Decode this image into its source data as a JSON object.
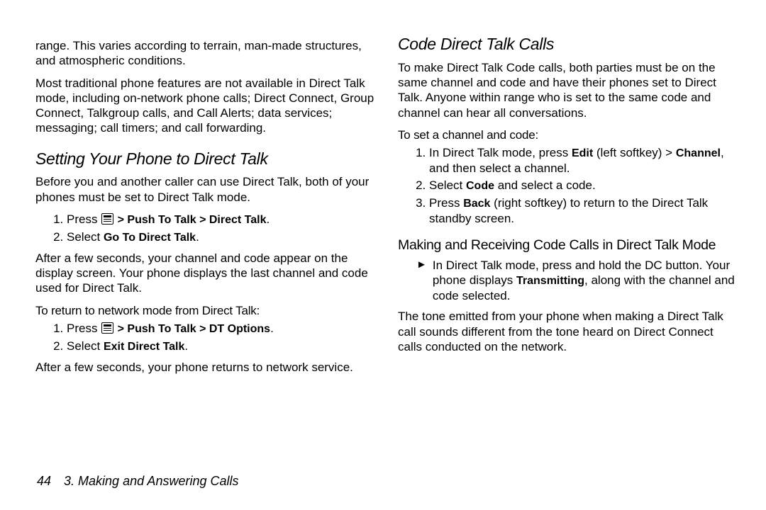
{
  "left": {
    "p_range": "range. This varies according to terrain, man-made structures, and atmospheric conditions.",
    "p_features": "Most traditional phone features are not available in Direct Talk mode, including on-network phone calls; Direct Connect, Group Connect, Talkgroup calls, and Call Alerts; data services; messaging; call timers; and call forwarding.",
    "h_setting": "Setting Your Phone to Direct Talk",
    "p_before": "Before you and another caller can use Direct Talk, both of your phones must be set to Direct Talk mode.",
    "step1_pre": "Press ",
    "step1_b": " > Push To Talk > Direct Talk",
    "step1_post": ".",
    "step2_pre": "Select ",
    "step2_b": "Go To Direct Talk",
    "step2_post": ".",
    "p_after_seconds": "After a few seconds, your channel and code appear on the display screen. Your phone displays the last channel and code used for Direct Talk.",
    "p_return_lead": "To return to network mode from Direct Talk:",
    "ret1_pre": "Press ",
    "ret1_b": " > Push To Talk > DT Options",
    "ret1_post": ".",
    "ret2_pre": "Select ",
    "ret2_b": "Exit Direct Talk",
    "ret2_post": ".",
    "p_returns": "After a few seconds, your phone returns to network service."
  },
  "right": {
    "h_code": "Code Direct Talk Calls",
    "p_make": "To make Direct Talk Code calls, both parties must be on the same channel and code and have their phones set to Direct Talk. Anyone within range who is set to the same code and channel can hear all conversations.",
    "p_set_lead": "To set a channel and code:",
    "s1_a": "In Direct Talk mode, press ",
    "s1_b1": "Edit",
    "s1_mid": " (left softkey) > ",
    "s1_b2": "Channel",
    "s1_end": ", and then select a channel.",
    "s2_a": "Select ",
    "s2_b": "Code",
    "s2_end": " and select a code.",
    "s3_a": "Press ",
    "s3_b": "Back",
    "s3_end": " (right softkey) to return to the Direct Talk standby screen.",
    "h_making": "Making and Receiving Code Calls in Direct Talk Mode",
    "bul_a": "In Direct Talk mode, press and hold the DC button. Your phone displays ",
    "bul_b": "Transmitting",
    "bul_end": ", along with the channel and code selected.",
    "p_tone": "The tone emitted from your phone when making a Direct Talk call sounds different from the tone heard on Direct Connect calls conducted on the network."
  },
  "footer": {
    "page": "44",
    "chapter": "3. Making and Answering Calls"
  }
}
